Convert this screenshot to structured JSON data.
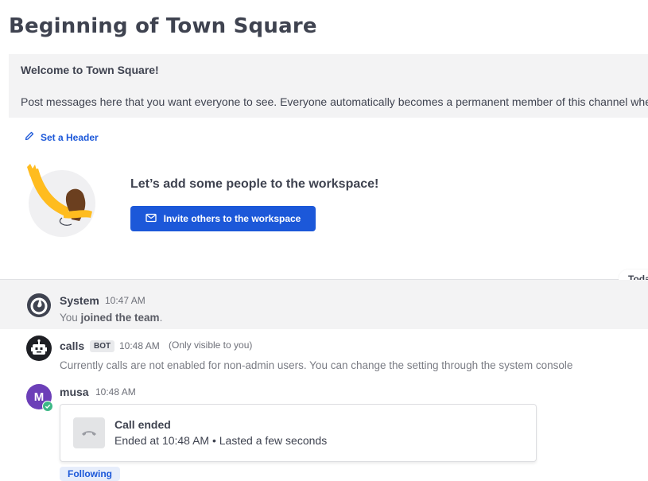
{
  "channel": {
    "intro_title": "Beginning of Town Square",
    "welcome_title": "Welcome to Town Square!",
    "welcome_description": "Post messages here that you want everyone to see. Everyone automatically becomes a permanent member of this channel when they join the team.",
    "set_header_label": "Set a Header"
  },
  "invite": {
    "title": "Let’s add some people to the workspace!",
    "button_label": "Invite others to the workspace"
  },
  "date_separator": "Today",
  "posts": [
    {
      "author": "System",
      "time": "10:47 AM",
      "message_prefix": "You ",
      "message_bold": "joined the team",
      "message_suffix": "."
    },
    {
      "author": "calls",
      "badge": "BOT",
      "time": "10:48 AM",
      "note": "(Only visible to you)",
      "message": "Currently calls are not enabled for non-admin users. You can change the setting through the system console"
    },
    {
      "author": "musa",
      "avatar_initial": "M",
      "time": "10:48 AM",
      "call_title": "Call ended",
      "call_subtitle": "Ended at 10:48 AM • Lasted a few seconds",
      "follow_label": "Following"
    }
  ],
  "colors": {
    "accent": "#1c58d9",
    "text": "#3f4350",
    "online": "#3db887",
    "musa_avatar": "#6c3fb8",
    "illustration_yellow": "#ffbc1f"
  }
}
